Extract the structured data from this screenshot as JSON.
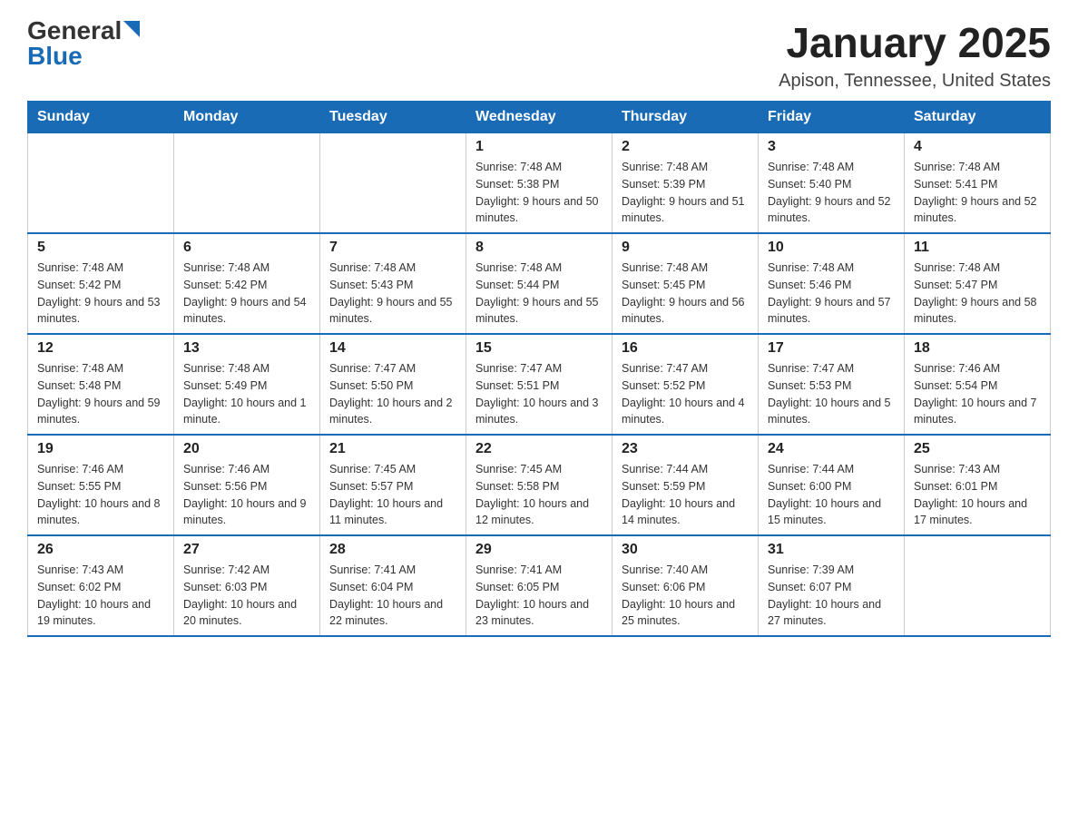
{
  "header": {
    "logo_general": "General",
    "logo_blue": "Blue",
    "title": "January 2025",
    "subtitle": "Apison, Tennessee, United States"
  },
  "days_of_week": [
    "Sunday",
    "Monday",
    "Tuesday",
    "Wednesday",
    "Thursday",
    "Friday",
    "Saturday"
  ],
  "weeks": [
    {
      "days": [
        {
          "number": "",
          "info": ""
        },
        {
          "number": "",
          "info": ""
        },
        {
          "number": "",
          "info": ""
        },
        {
          "number": "1",
          "info": "Sunrise: 7:48 AM\nSunset: 5:38 PM\nDaylight: 9 hours and 50 minutes."
        },
        {
          "number": "2",
          "info": "Sunrise: 7:48 AM\nSunset: 5:39 PM\nDaylight: 9 hours and 51 minutes."
        },
        {
          "number": "3",
          "info": "Sunrise: 7:48 AM\nSunset: 5:40 PM\nDaylight: 9 hours and 52 minutes."
        },
        {
          "number": "4",
          "info": "Sunrise: 7:48 AM\nSunset: 5:41 PM\nDaylight: 9 hours and 52 minutes."
        }
      ]
    },
    {
      "days": [
        {
          "number": "5",
          "info": "Sunrise: 7:48 AM\nSunset: 5:42 PM\nDaylight: 9 hours and 53 minutes."
        },
        {
          "number": "6",
          "info": "Sunrise: 7:48 AM\nSunset: 5:42 PM\nDaylight: 9 hours and 54 minutes."
        },
        {
          "number": "7",
          "info": "Sunrise: 7:48 AM\nSunset: 5:43 PM\nDaylight: 9 hours and 55 minutes."
        },
        {
          "number": "8",
          "info": "Sunrise: 7:48 AM\nSunset: 5:44 PM\nDaylight: 9 hours and 55 minutes."
        },
        {
          "number": "9",
          "info": "Sunrise: 7:48 AM\nSunset: 5:45 PM\nDaylight: 9 hours and 56 minutes."
        },
        {
          "number": "10",
          "info": "Sunrise: 7:48 AM\nSunset: 5:46 PM\nDaylight: 9 hours and 57 minutes."
        },
        {
          "number": "11",
          "info": "Sunrise: 7:48 AM\nSunset: 5:47 PM\nDaylight: 9 hours and 58 minutes."
        }
      ]
    },
    {
      "days": [
        {
          "number": "12",
          "info": "Sunrise: 7:48 AM\nSunset: 5:48 PM\nDaylight: 9 hours and 59 minutes."
        },
        {
          "number": "13",
          "info": "Sunrise: 7:48 AM\nSunset: 5:49 PM\nDaylight: 10 hours and 1 minute."
        },
        {
          "number": "14",
          "info": "Sunrise: 7:47 AM\nSunset: 5:50 PM\nDaylight: 10 hours and 2 minutes."
        },
        {
          "number": "15",
          "info": "Sunrise: 7:47 AM\nSunset: 5:51 PM\nDaylight: 10 hours and 3 minutes."
        },
        {
          "number": "16",
          "info": "Sunrise: 7:47 AM\nSunset: 5:52 PM\nDaylight: 10 hours and 4 minutes."
        },
        {
          "number": "17",
          "info": "Sunrise: 7:47 AM\nSunset: 5:53 PM\nDaylight: 10 hours and 5 minutes."
        },
        {
          "number": "18",
          "info": "Sunrise: 7:46 AM\nSunset: 5:54 PM\nDaylight: 10 hours and 7 minutes."
        }
      ]
    },
    {
      "days": [
        {
          "number": "19",
          "info": "Sunrise: 7:46 AM\nSunset: 5:55 PM\nDaylight: 10 hours and 8 minutes."
        },
        {
          "number": "20",
          "info": "Sunrise: 7:46 AM\nSunset: 5:56 PM\nDaylight: 10 hours and 9 minutes."
        },
        {
          "number": "21",
          "info": "Sunrise: 7:45 AM\nSunset: 5:57 PM\nDaylight: 10 hours and 11 minutes."
        },
        {
          "number": "22",
          "info": "Sunrise: 7:45 AM\nSunset: 5:58 PM\nDaylight: 10 hours and 12 minutes."
        },
        {
          "number": "23",
          "info": "Sunrise: 7:44 AM\nSunset: 5:59 PM\nDaylight: 10 hours and 14 minutes."
        },
        {
          "number": "24",
          "info": "Sunrise: 7:44 AM\nSunset: 6:00 PM\nDaylight: 10 hours and 15 minutes."
        },
        {
          "number": "25",
          "info": "Sunrise: 7:43 AM\nSunset: 6:01 PM\nDaylight: 10 hours and 17 minutes."
        }
      ]
    },
    {
      "days": [
        {
          "number": "26",
          "info": "Sunrise: 7:43 AM\nSunset: 6:02 PM\nDaylight: 10 hours and 19 minutes."
        },
        {
          "number": "27",
          "info": "Sunrise: 7:42 AM\nSunset: 6:03 PM\nDaylight: 10 hours and 20 minutes."
        },
        {
          "number": "28",
          "info": "Sunrise: 7:41 AM\nSunset: 6:04 PM\nDaylight: 10 hours and 22 minutes."
        },
        {
          "number": "29",
          "info": "Sunrise: 7:41 AM\nSunset: 6:05 PM\nDaylight: 10 hours and 23 minutes."
        },
        {
          "number": "30",
          "info": "Sunrise: 7:40 AM\nSunset: 6:06 PM\nDaylight: 10 hours and 25 minutes."
        },
        {
          "number": "31",
          "info": "Sunrise: 7:39 AM\nSunset: 6:07 PM\nDaylight: 10 hours and 27 minutes."
        },
        {
          "number": "",
          "info": ""
        }
      ]
    }
  ]
}
